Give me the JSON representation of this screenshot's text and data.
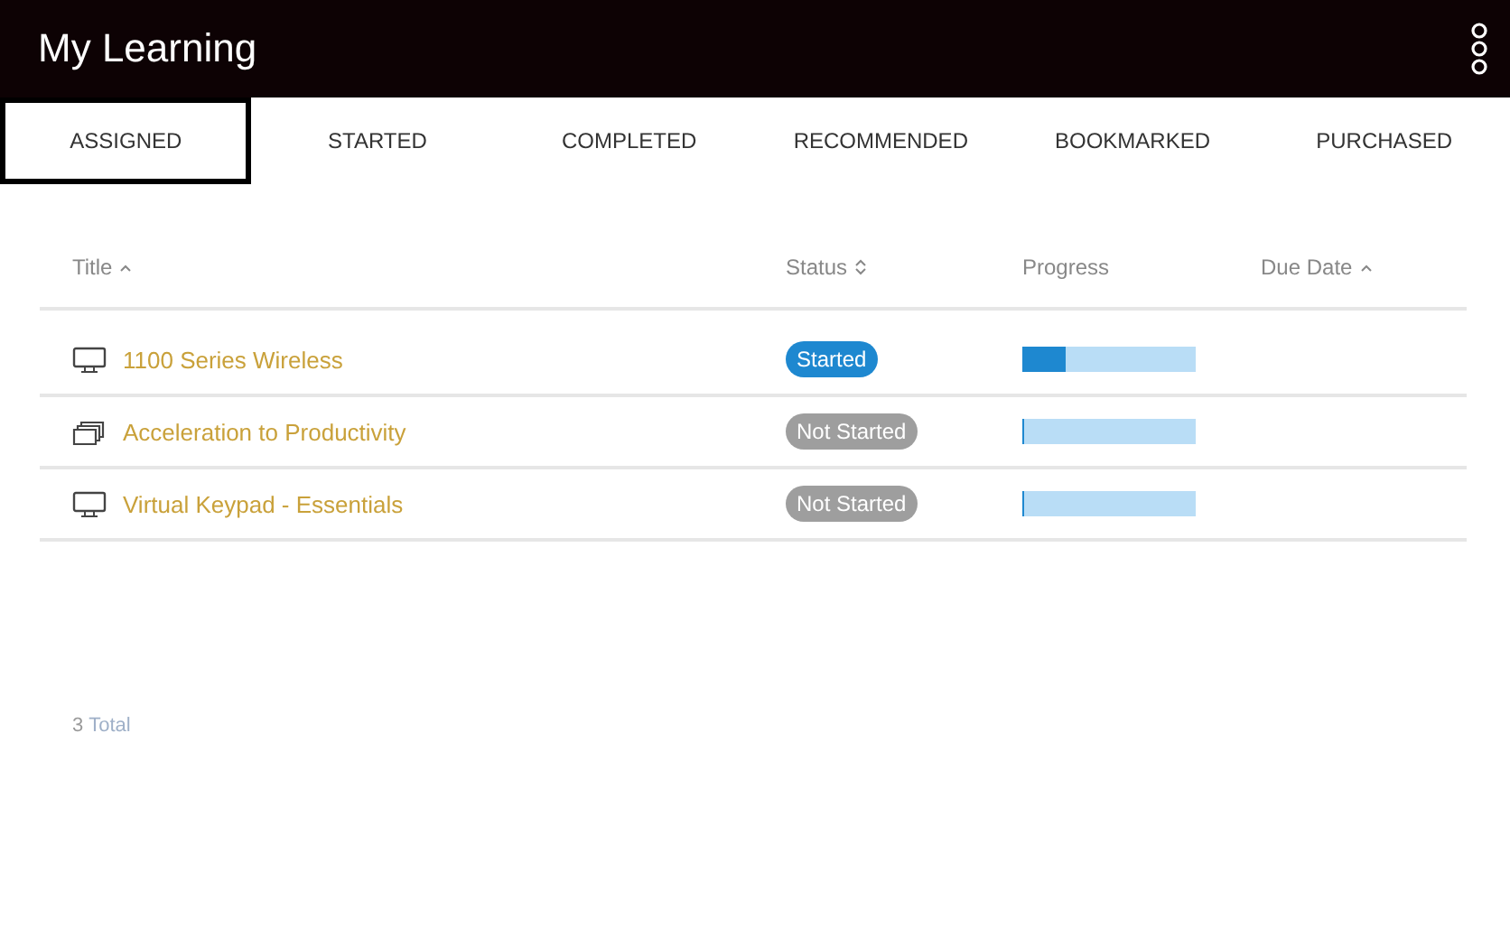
{
  "app_bar": {
    "title": "My Learning"
  },
  "tabs": [
    {
      "label": "ASSIGNED",
      "selected": true
    },
    {
      "label": "STARTED",
      "selected": false
    },
    {
      "label": "COMPLETED",
      "selected": false
    },
    {
      "label": "RECOMMENDED",
      "selected": false
    },
    {
      "label": "BOOKMARKED",
      "selected": false
    },
    {
      "label": "PURCHASED",
      "selected": false
    }
  ],
  "table": {
    "columns": [
      {
        "label": "Title",
        "kind": "sort_asc"
      },
      {
        "label": "Status",
        "kind": "sort_both"
      },
      {
        "label": "Progress",
        "kind": "plain"
      },
      {
        "label": "Due Date",
        "kind": "sort_asc"
      }
    ],
    "rows": [
      {
        "kind": "course",
        "title": "1100 Series Wireless",
        "status": {
          "label": "Started",
          "kind": "started"
        },
        "level": 0.25
      },
      {
        "kind": "bundle",
        "title": "Acceleration to Productivity",
        "status": {
          "label": "Not Started",
          "kind": "not_started"
        },
        "level": 0
      },
      {
        "kind": "course",
        "title": "Virtual Keypad - Essentials",
        "status": {
          "label": "Not Started",
          "kind": "not_started"
        },
        "level": 0
      }
    ]
  },
  "total": {
    "count": "3",
    "label": "Total"
  }
}
